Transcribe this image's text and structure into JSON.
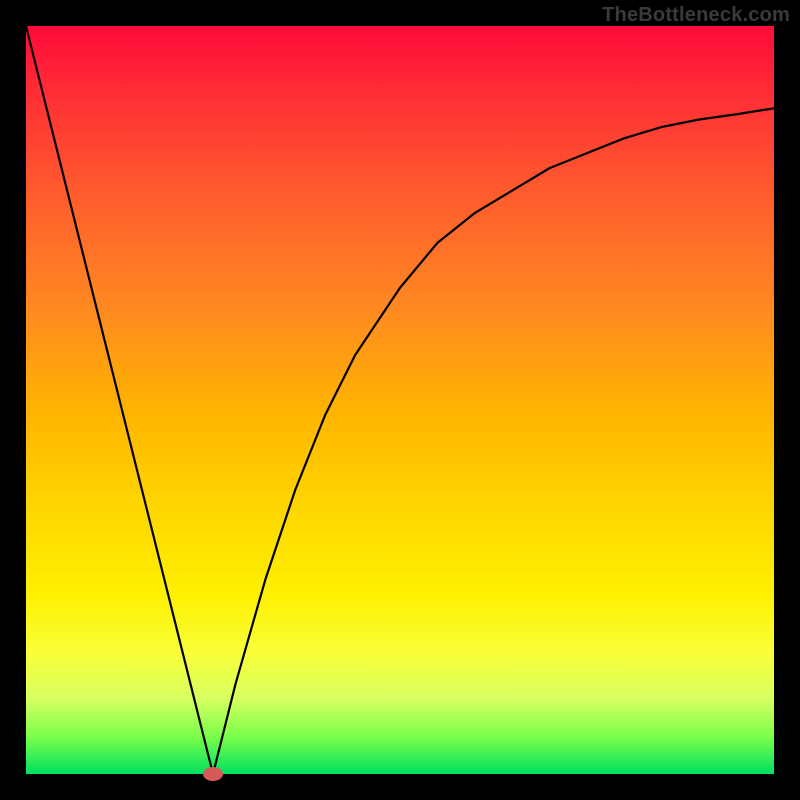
{
  "watermark": "TheBottleneck.com",
  "chart_data": {
    "type": "line",
    "title": "",
    "xlabel": "",
    "ylabel": "",
    "xlim": [
      0,
      100
    ],
    "ylim": [
      0,
      100
    ],
    "grid": false,
    "legend": false,
    "series": [
      {
        "name": "bottleneck-curve",
        "x": [
          0,
          2,
          4,
          6,
          8,
          10,
          12,
          14,
          16,
          18,
          20,
          22,
          24,
          25,
          26,
          28,
          30,
          32,
          34,
          36,
          38,
          40,
          42,
          44,
          46,
          48,
          50,
          55,
          60,
          65,
          70,
          75,
          80,
          85,
          90,
          95,
          100
        ],
        "values": [
          100,
          92,
          84,
          76,
          68,
          60,
          52,
          44,
          36,
          28,
          20,
          12,
          4,
          0,
          4,
          12,
          19,
          26,
          32,
          38,
          43,
          48,
          52,
          56,
          59,
          62,
          65,
          71,
          75,
          78,
          81,
          83,
          85,
          86.5,
          87.5,
          88.2,
          89
        ]
      }
    ],
    "marker": {
      "x": 25,
      "y": 0,
      "color": "#d65a5a",
      "rx": 10,
      "ry": 7
    },
    "colors": {
      "curve": "#000000",
      "background_top": "#ff0a3a",
      "background_bottom": "#00e060"
    }
  }
}
